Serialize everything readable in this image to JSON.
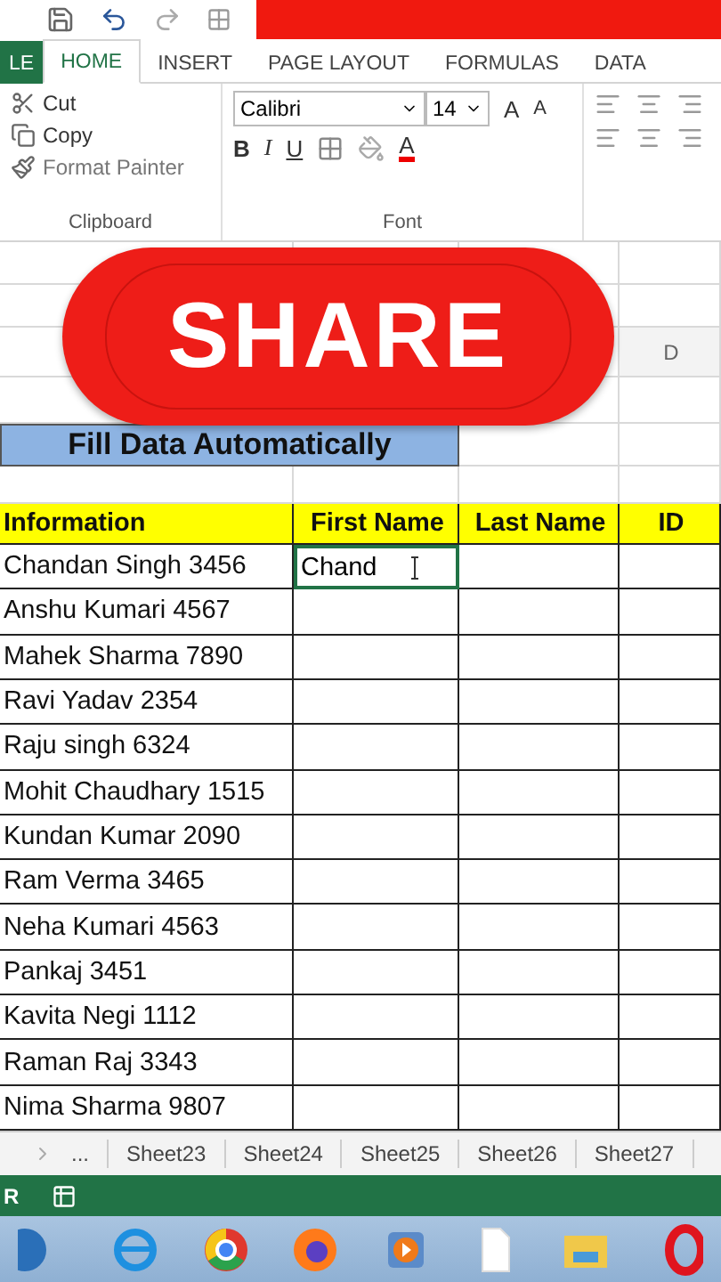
{
  "tabs": [
    {
      "label": "LE",
      "kind": "file",
      "selected": false
    },
    {
      "label": "HOME",
      "kind": "tab",
      "selected": true
    },
    {
      "label": "INSERT",
      "kind": "tab",
      "selected": false
    },
    {
      "label": "PAGE LAYOUT",
      "kind": "tab",
      "selected": false
    },
    {
      "label": "FORMULAS",
      "kind": "tab",
      "selected": false
    },
    {
      "label": "DATA",
      "kind": "tab",
      "selected": false
    }
  ],
  "clipboard": {
    "items": [
      "Cut",
      "Copy",
      "Format Painter"
    ],
    "label": "Clipboard"
  },
  "font": {
    "name": "Calibri",
    "size": "14",
    "grow": "A",
    "shrink": "A",
    "styles": [
      "B",
      "I",
      "U"
    ],
    "color_letter": "A",
    "label": "Font"
  },
  "overlay": {
    "label": "SHARE"
  },
  "sheet": {
    "column_header": "D",
    "title": "Fill Data Automatically",
    "columns": [
      "Information",
      "First Name",
      "Last Name",
      "ID"
    ],
    "rows": [
      {
        "information": "Chandan Singh 3456",
        "first_name": "Chand",
        "selected": true
      },
      {
        "information": "Anshu Kumari 4567",
        "selected": false
      },
      {
        "information": "Mahek Sharma 7890",
        "selected": false
      },
      {
        "information": "Ravi Yadav 2354",
        "selected": false
      },
      {
        "information": "Raju singh 6324",
        "selected": false
      },
      {
        "information": "Mohit Chaudhary 1515",
        "selected": false
      },
      {
        "information": "Kundan Kumar 2090",
        "selected": false
      },
      {
        "information": "Ram Verma 3465",
        "selected": false
      },
      {
        "information": "Neha Kumari 4563",
        "selected": false
      },
      {
        "information": "Pankaj 3451",
        "selected": false
      },
      {
        "information": "Kavita Negi 1112",
        "selected": false
      },
      {
        "information": "Raman Raj 3343",
        "selected": false
      },
      {
        "information": "Nima Sharma 9807",
        "selected": false
      }
    ]
  },
  "sheet_tabs": [
    "...",
    "Sheet23",
    "Sheet24",
    "Sheet25",
    "Sheet26",
    "Sheet27"
  ],
  "status_bar": {
    "mode": "R"
  }
}
